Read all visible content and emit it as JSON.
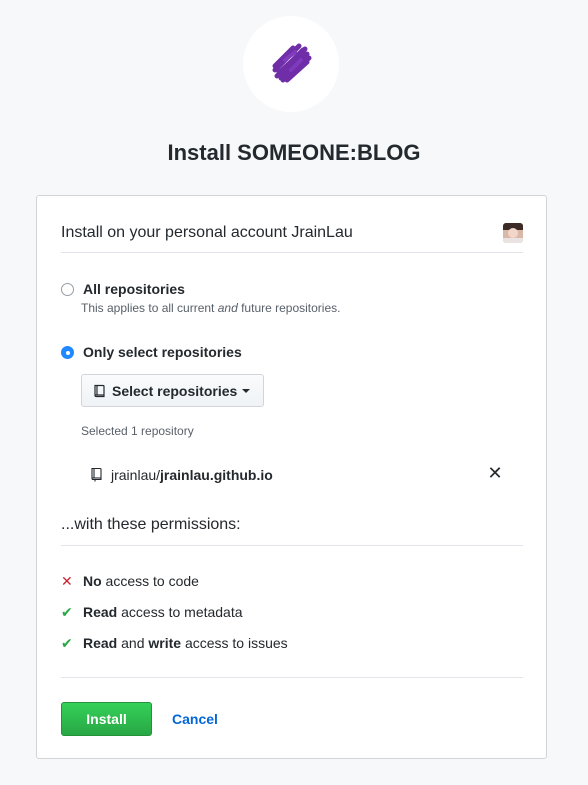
{
  "page": {
    "title": "Install SOMEONE:BLOG"
  },
  "account": {
    "text": "Install on your personal account JrainLau"
  },
  "options": {
    "all": {
      "label": "All repositories",
      "note_pre": "This applies to all current ",
      "note_em": "and",
      "note_post": " future repositories.",
      "checked": false
    },
    "select": {
      "label": "Only select repositories",
      "checked": true
    }
  },
  "select_button": {
    "label": "Select repositories"
  },
  "selected": {
    "count_text": "Selected 1 repository",
    "repos": [
      {
        "owner": "jrainlau/",
        "name": "jrainlau.github.io"
      }
    ]
  },
  "permissions": {
    "heading": "...with these permissions:",
    "items": [
      {
        "icon": "x-icon",
        "parts": [
          {
            "t": "No",
            "b": true
          },
          {
            "t": " access to code",
            "b": false
          }
        ]
      },
      {
        "icon": "check-icon",
        "parts": [
          {
            "t": "Read",
            "b": true
          },
          {
            "t": " access to metadata",
            "b": false
          }
        ]
      },
      {
        "icon": "check-icon",
        "parts": [
          {
            "t": "Read",
            "b": true
          },
          {
            "t": " and ",
            "b": false
          },
          {
            "t": "write",
            "b": true
          },
          {
            "t": " access to issues",
            "b": false
          }
        ]
      }
    ]
  },
  "actions": {
    "install_label": "Install",
    "cancel_label": "Cancel"
  },
  "colors": {
    "brand_purple": "#6f2da8",
    "install_green": "#28a745",
    "link_blue": "#0366d6",
    "radio_blue": "#2188ff",
    "error_red": "#cb2431"
  }
}
